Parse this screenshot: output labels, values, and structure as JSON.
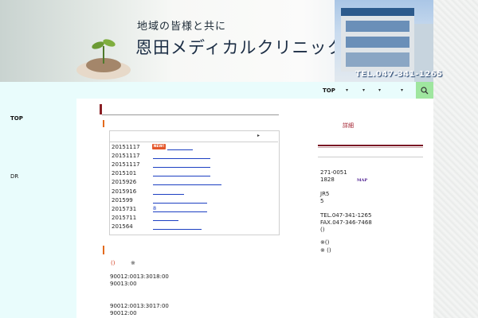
{
  "header": {
    "slogan": "地域の皆様と共に",
    "clinic_name": "恩田メディカルクリニック",
    "tel": "TEL.047-341-1265"
  },
  "sidebar_left": {
    "top_label": "TOP",
    "dr_label": "DR"
  },
  "nav": {
    "top_label": "TOP",
    "dropdown_arrows": [
      "▾",
      "▾",
      "▾",
      "▾"
    ],
    "search_icon": "search-icon"
  },
  "news": {
    "head_arrow": "▸",
    "badge": "NEW!",
    "items": [
      {
        "date": "20151117",
        "is_new": true,
        "link_width": 32
      },
      {
        "date": "20151117",
        "is_new": false,
        "link_width": 72
      },
      {
        "date": "20151117",
        "is_new": false,
        "link_width": 72
      },
      {
        "date": "2015101",
        "is_new": false,
        "link_width": 72
      },
      {
        "date": "2015926",
        "is_new": false,
        "link_width": 86
      },
      {
        "date": "2015916",
        "is_new": false,
        "link_width": 39
      },
      {
        "date": "201599",
        "is_new": false,
        "link_width": 68
      },
      {
        "date": "2015731",
        "is_new": false,
        "link_width": 68,
        "link_text": "8"
      },
      {
        "date": "2015711",
        "is_new": false,
        "link_width": 32
      },
      {
        "date": "201564",
        "is_new": false,
        "link_width": 61
      }
    ]
  },
  "hours": {
    "paren": "()",
    "star": "※",
    "lines": [
      "90012:0013:3018:00",
      "90013:00",
      "90012:0013:3017:00",
      "90012:00"
    ]
  },
  "sidebar_right": {
    "detail_link": "詳細",
    "postal": "271-0051",
    "address": "1828",
    "map_link": "MAP",
    "station": "JR5",
    "walk": "5",
    "tel": "TEL.047-341-1265",
    "fax": "FAX.047-346-7468",
    "paren": "()",
    "note1": "※()",
    "note2": "※ ()"
  },
  "colors": {
    "accent_red": "#8a1f24",
    "accent_orange": "#e36a1d",
    "link_blue": "#1c3fc2",
    "badge": "#e4562a",
    "search_green": "#9fe69f",
    "left_bg": "#e9fcfc"
  }
}
